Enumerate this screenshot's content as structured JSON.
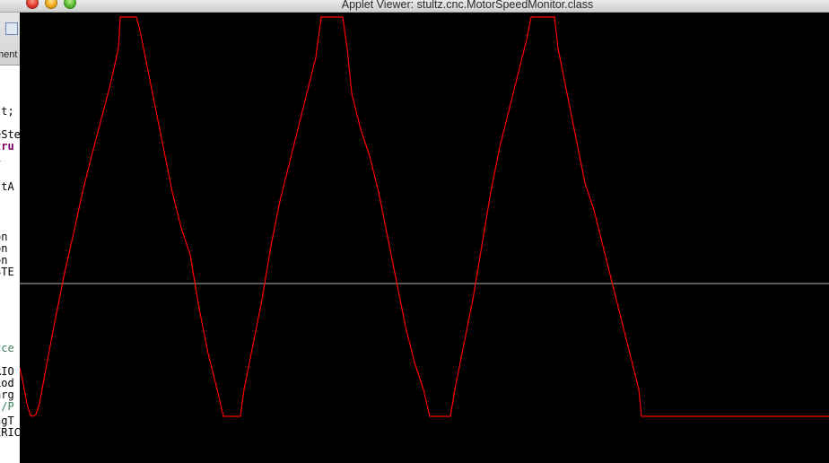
{
  "window": {
    "title": "Applet Viewer: stultz.cnc.MotorSpeedMonitor.class",
    "buttons": {
      "close": "close",
      "minimize": "minimize",
      "zoom": "zoom"
    }
  },
  "background_editor": {
    "tab_fragment": "ment",
    "code_fragments": [
      {
        "text": "st;",
        "style": "normal"
      },
      {
        "text": " {",
        "style": "normal"
      },
      {
        "text": "eSte",
        "style": "normal"
      },
      {
        "text": "tru",
        "style": "kw"
      },
      {
        "text": " 1",
        "style": "normal"
      },
      {
        "text": "stA",
        "style": "normal"
      },
      {
        "text": "on",
        "style": "normal"
      },
      {
        "text": "on",
        "style": "normal"
      },
      {
        "text": "on",
        "style": "normal"
      },
      {
        "text": "STE",
        "style": "normal"
      },
      {
        "text": "cce",
        "style": "cm"
      },
      {
        "text": "RIO",
        "style": "normal"
      },
      {
        "text": "Lod",
        "style": "normal"
      },
      {
        "text": "arg",
        "style": "normal"
      },
      {
        "text": "//P",
        "style": "cm"
      },
      {
        "text": "ngT",
        "style": "normal"
      },
      {
        "text": "ERIC",
        "style": "normal"
      }
    ]
  },
  "monitor": {
    "background_color": "#000000",
    "trace_color": "#ff0000",
    "centerline_color": "#b4b4b4",
    "waveform": "trapezoidal speed profile: 3 peaks, returns to minimum and holds flat",
    "peaks": 3
  }
}
